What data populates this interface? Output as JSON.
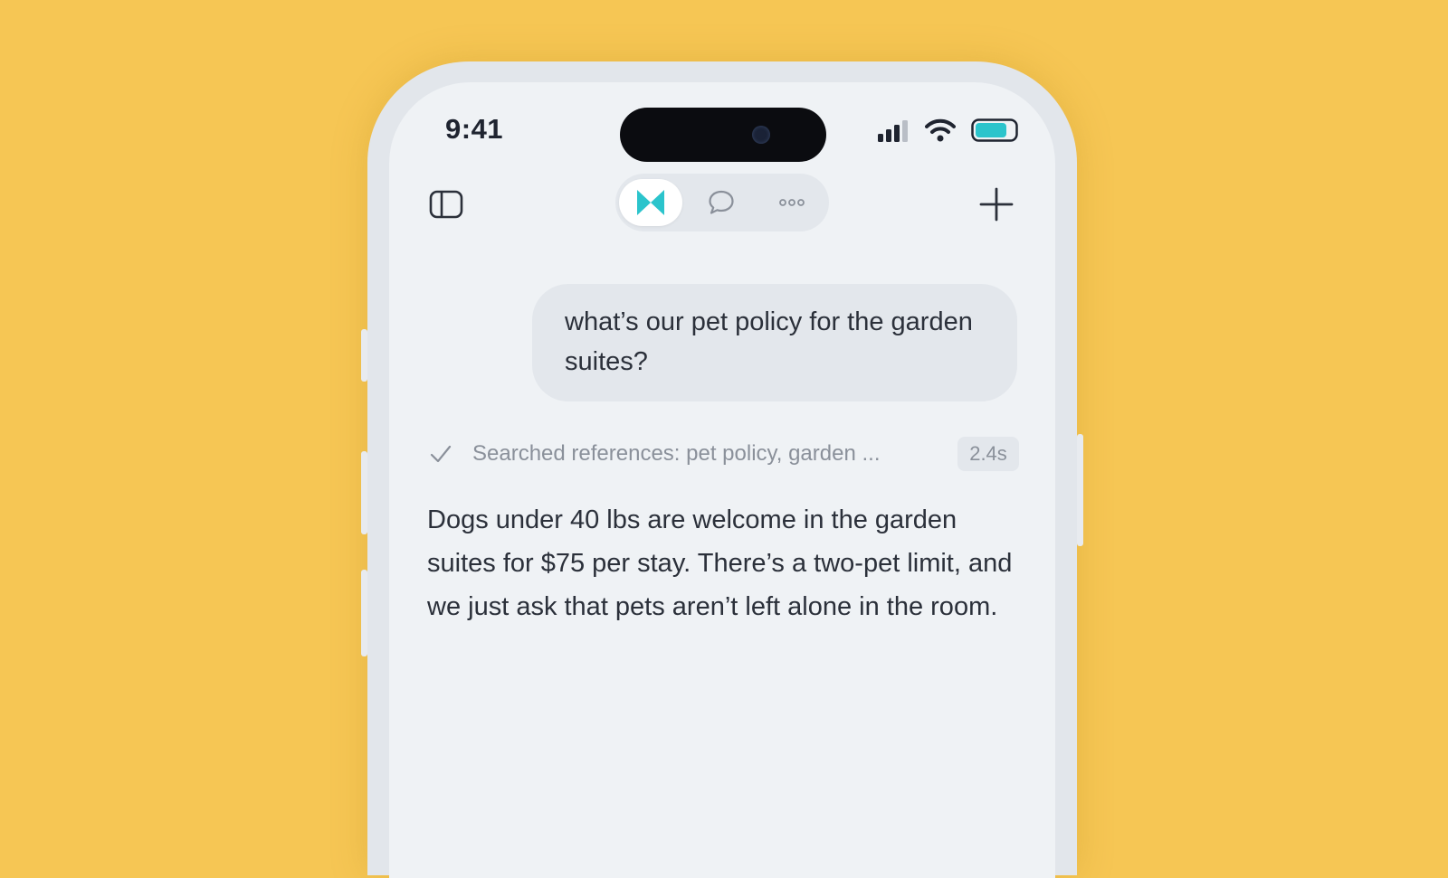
{
  "status_bar": {
    "time": "9:41"
  },
  "toolbar": {
    "tabs": [
      {
        "icon": "logo-icon",
        "active": true
      },
      {
        "icon": "chat-bubble-icon",
        "active": false
      },
      {
        "icon": "more-dots-icon",
        "active": false
      }
    ],
    "accent_color": "#2BC4CC"
  },
  "chat": {
    "user_message": "what’s our pet policy for the garden suites?",
    "search_status": "Searched references: pet policy, garden ...",
    "search_duration": "2.4s",
    "assistant_reply": "Dogs under 40 lbs are welcome in the garden suites for $75 per stay. There’s a two-pet limit, and we just ask that pets aren’t left alone in the room."
  },
  "colors": {
    "background": "#F6C654",
    "screen": "#EFF2F5",
    "battery_fill": "#2BC4CC"
  }
}
